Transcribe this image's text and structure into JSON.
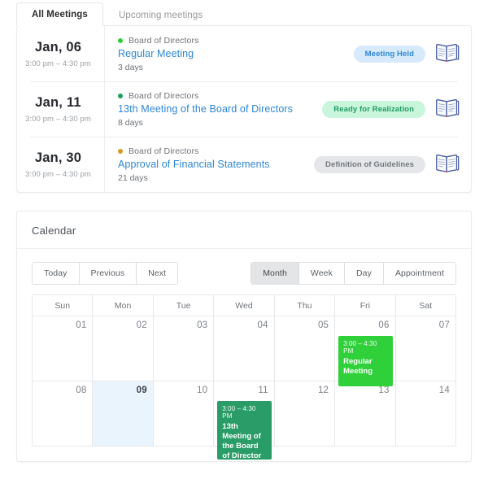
{
  "tabs": [
    {
      "label": "All Meetings",
      "active": true
    },
    {
      "label": "Upcoming meetings",
      "active": false
    }
  ],
  "meetings": [
    {
      "date": "Jan, 06",
      "time": "3:00 pm – 4:30 pm",
      "category": "Board of Directors",
      "dot_color": "#30d03a",
      "title": "Regular Meeting",
      "days": "3 days",
      "status": "Meeting Held",
      "status_bg": "#d7eafb",
      "status_fg": "#2f86d4",
      "icon": "minutes-book-icon"
    },
    {
      "date": "Jan, 11",
      "time": "3:00 pm – 4:30 pm",
      "category": "Board of Directors",
      "dot_color": "#1f9d62",
      "title": "13th Meeting of the Board of Directors",
      "days": "8 days",
      "status": "Ready for Realization",
      "status_bg": "#c9f5dd",
      "status_fg": "#1f9d62",
      "icon": "minutes-book-icon"
    },
    {
      "date": "Jan, 30",
      "time": "3:00 pm – 4:30 pm",
      "category": "Board of Directors",
      "dot_color": "#d79b22",
      "title": "Approval of Financial Statements",
      "days": "21 days",
      "status": "Definition of Guidelines",
      "status_bg": "#e4e6e9",
      "status_fg": "#72777d",
      "icon": "minutes-book-icon"
    }
  ],
  "calendar": {
    "title": "Calendar",
    "nav_buttons": [
      {
        "label": "Today",
        "active": false
      },
      {
        "label": "Previous",
        "active": false
      },
      {
        "label": "Next",
        "active": false
      }
    ],
    "view_buttons": [
      {
        "label": "Month",
        "active": true
      },
      {
        "label": "Week",
        "active": false
      },
      {
        "label": "Day",
        "active": false
      },
      {
        "label": "Appointment",
        "active": false
      }
    ],
    "weekday_headers": [
      "Sun",
      "Mon",
      "Tue",
      "Wed",
      "Thu",
      "Fri",
      "Sat"
    ],
    "weeks": [
      [
        {
          "num": "01"
        },
        {
          "num": "02"
        },
        {
          "num": "03"
        },
        {
          "num": "04"
        },
        {
          "num": "05"
        },
        {
          "num": "06"
        },
        {
          "num": "07"
        }
      ],
      [
        {
          "num": "08"
        },
        {
          "num": "09",
          "today": true
        },
        {
          "num": "10"
        },
        {
          "num": "11"
        },
        {
          "num": "12"
        },
        {
          "num": "13"
        },
        {
          "num": "14"
        }
      ]
    ],
    "events": [
      {
        "time": "3:00 – 4:30 PM",
        "title": "Regular Meeting",
        "color": "#30d03a",
        "week": 0,
        "day": 5,
        "height": 62
      },
      {
        "time": "3:00 – 4:30 PM",
        "title": "13th Meeting of the Board of Director",
        "color": "#2a9c68",
        "week": 1,
        "day": 3,
        "height": 72
      }
    ]
  }
}
